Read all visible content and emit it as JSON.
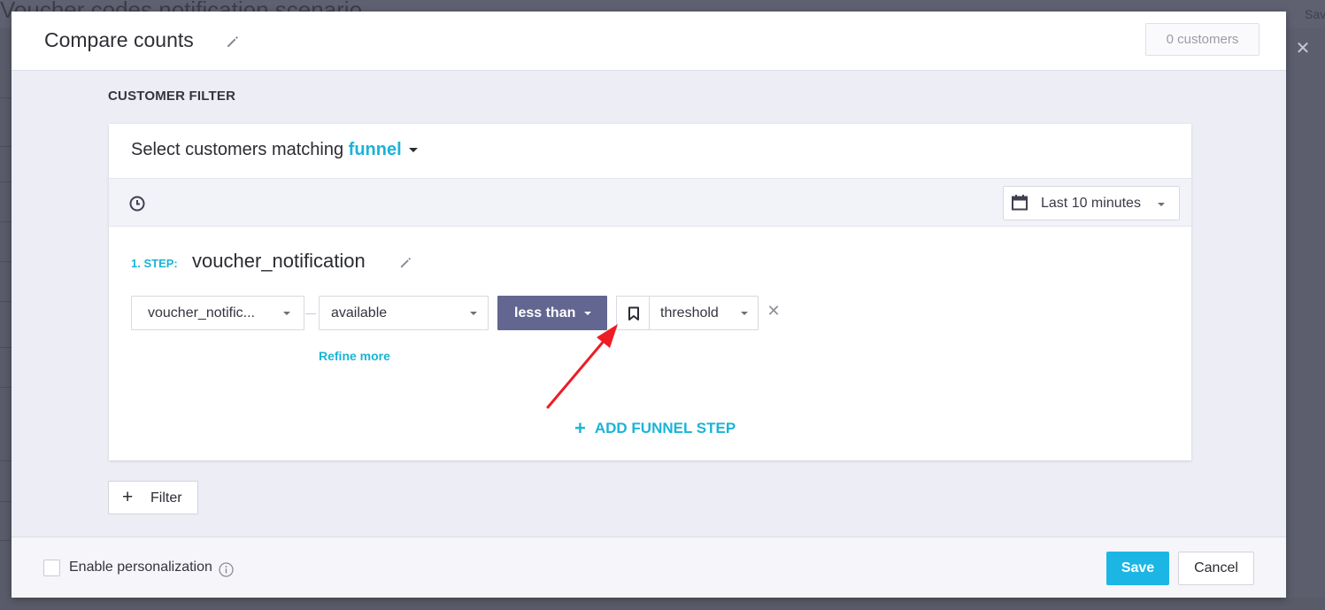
{
  "background": {
    "page_title_fragment": "Voucher codes notification scenario",
    "top_right_fragment": "Sav"
  },
  "modal": {
    "title": "Compare counts",
    "customer_count": "0 customers",
    "section_label": "CUSTOMER FILTER",
    "card": {
      "heading_prefix": "Select customers matching",
      "heading_mode": "funnel",
      "date_range": "Last 10 minutes",
      "step": {
        "label": "1. STEP:",
        "name": "voucher_notification",
        "event_select": "voucher_notific...",
        "property_select": "available",
        "operator_select": "less than",
        "value_select": "threshold",
        "refine_link": "Refine more"
      },
      "add_step_label": "ADD FUNNEL STEP"
    },
    "filter_button": "Filter",
    "footer": {
      "personalization_label": "Enable personalization",
      "personalization_checked": false,
      "save_label": "Save",
      "cancel_label": "Cancel"
    }
  },
  "colors": {
    "accent": "#1ab4d7",
    "save_button": "#1cb6e4",
    "operator_button": "#626691",
    "annotation_arrow": "#ee1c24"
  },
  "icons": [
    "pencil-icon",
    "clock-icon",
    "calendar-icon",
    "bookmark-icon",
    "close-icon",
    "plus-icon",
    "info-icon",
    "chevron-down-icon",
    "annotation-arrow"
  ]
}
